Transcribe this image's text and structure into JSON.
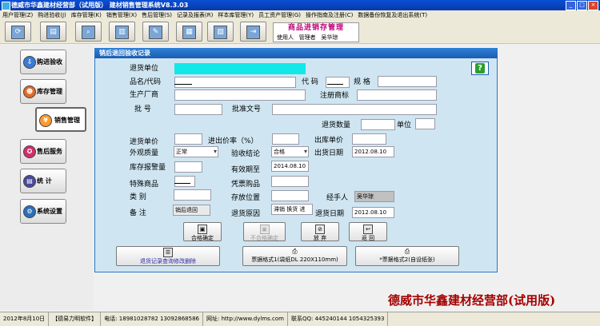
{
  "window": {
    "title": "德威市华鑫建材经营部（试用版）  建材销售管理系统V8.3.03",
    "controls": [
      "_",
      "□",
      "×"
    ]
  },
  "menu": [
    "用户管理(Z)",
    "购进验收(J)",
    "库存管理(K)",
    "销售管理(X)",
    "售后管理(S)",
    "记录及报表(R)",
    "样本库管理(Y)",
    "员工资产管理(G)",
    "操作指南及注册(C)",
    "数据备份恢复及退出系统(T)"
  ],
  "toolbar": {
    "buttons": [
      {
        "name": "refresh-icon",
        "glyph": "⟳"
      },
      {
        "name": "document-icon",
        "glyph": "▤"
      },
      {
        "name": "search-icon",
        "glyph": "⌕"
      },
      {
        "name": "report-icon",
        "glyph": "▥"
      },
      {
        "name": "edit-icon",
        "glyph": "✎"
      },
      {
        "name": "ledger-icon",
        "glyph": "▦"
      },
      {
        "name": "notebook-icon",
        "glyph": "▧"
      },
      {
        "name": "exit-icon",
        "glyph": "⇥"
      }
    ],
    "banner_title": "商品进销存管理",
    "user_label": "使用人",
    "user_role": "管理者",
    "user_name": "吴华琼"
  },
  "sidebar": [
    {
      "label": "购进验收",
      "icon": "purchase-icon",
      "glyph": "⇩",
      "color": "#3a7bd5"
    },
    {
      "label": "库存管理",
      "icon": "inventory-icon",
      "glyph": "☻",
      "color": "#e06a2a"
    },
    {
      "label": "销售管理",
      "icon": "sales-icon",
      "glyph": "¥",
      "color": "#ff9a2e",
      "active": true
    },
    {
      "label": "售后服务",
      "icon": "service-icon",
      "glyph": "✪",
      "color": "#d02f6a"
    },
    {
      "label": "统 计",
      "icon": "statistics-icon",
      "glyph": "▤",
      "color": "#4a4a9a"
    },
    {
      "label": "系统设置",
      "icon": "settings-icon",
      "glyph": "⚙",
      "color": "#2b6fb8"
    }
  ],
  "panel": {
    "title": "销后退回验收记录",
    "labels": {
      "return_unit": "退货单位",
      "name_code": "品名/代码",
      "code": "代  码",
      "spec": "规  格",
      "manufacturer": "生产厂商",
      "reg_trademark": "注册商标",
      "batch_no": "批    号",
      "approval_no": "批准文号",
      "return_qty": "退货数量",
      "unit": "单位",
      "return_price": "进货单价",
      "markup": "进出价率（%）",
      "sale_price": "出库单价",
      "appearance": "外观质量",
      "acceptance": "验收结论",
      "ship_date": "出货日期",
      "stock_alert": "库存报警量",
      "valid_until": "有效期至",
      "special_goods": "特殊商品",
      "voucher": "凭票购品",
      "category": "类    别",
      "storage": "存放位置",
      "handler": "经手人",
      "remark": "备    注",
      "return_reason": "退货原因",
      "return_date": "退货日期"
    },
    "values": {
      "appearance": "正常",
      "acceptance": "合格",
      "ship_date": "2012.08.10",
      "valid_until": "2014.08.10",
      "handler": "吴华琼",
      "remark": "销后退回",
      "return_reason": "滞销 换货 进",
      "return_date": "2012.08.10"
    }
  },
  "actions": {
    "qualified_confirm": "合格确定",
    "unqualified_confirm": "不合格确定",
    "abandon": "放 弃",
    "back": "返 回",
    "query_modify": "退货记录查询修改删除",
    "print_format1": "票据格式1(袋纸DL 220X110mm)",
    "print_format2": "*票据格式2(自设纸张)"
  },
  "company_name": "德威市华鑫建材经营部(试用版)",
  "status": {
    "date": "2012年8月10日",
    "vendor": "【德易力明软件】",
    "phone_label": "电话:",
    "phones": "18981028782  13092868586",
    "site_label": "网址:",
    "site": "http://www.dylms.com",
    "qq_label": "联系QQ:",
    "qq": "445240144  1054325393"
  }
}
